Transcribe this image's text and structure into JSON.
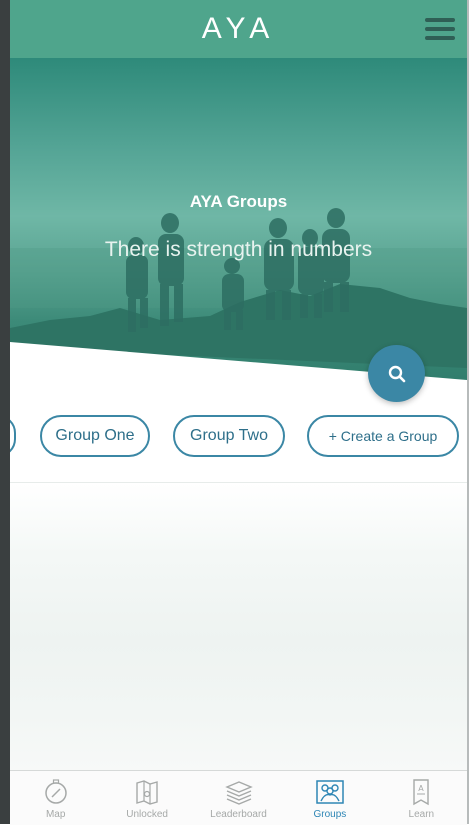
{
  "app": {
    "brand": "AYA"
  },
  "hero": {
    "title": "AYA Groups",
    "subtitle": "There is strength in numbers"
  },
  "groups": {
    "items": [
      "Group One",
      "Group Two"
    ],
    "create_label": "+ Create a Group"
  },
  "tabs": [
    {
      "label": "Map",
      "icon": "compass-icon",
      "active": false
    },
    {
      "label": "Unlocked",
      "icon": "map-icon",
      "active": false
    },
    {
      "label": "Leaderboard",
      "icon": "layers-icon",
      "active": false
    },
    {
      "label": "Groups",
      "icon": "people-icon",
      "active": true
    },
    {
      "label": "Learn",
      "icon": "book-icon",
      "active": false
    }
  ],
  "colors": {
    "accent": "#3b87a5",
    "header": "#4fa58c",
    "active_tab": "#2e86b5",
    "inactive_tab": "#a6a9a8"
  }
}
